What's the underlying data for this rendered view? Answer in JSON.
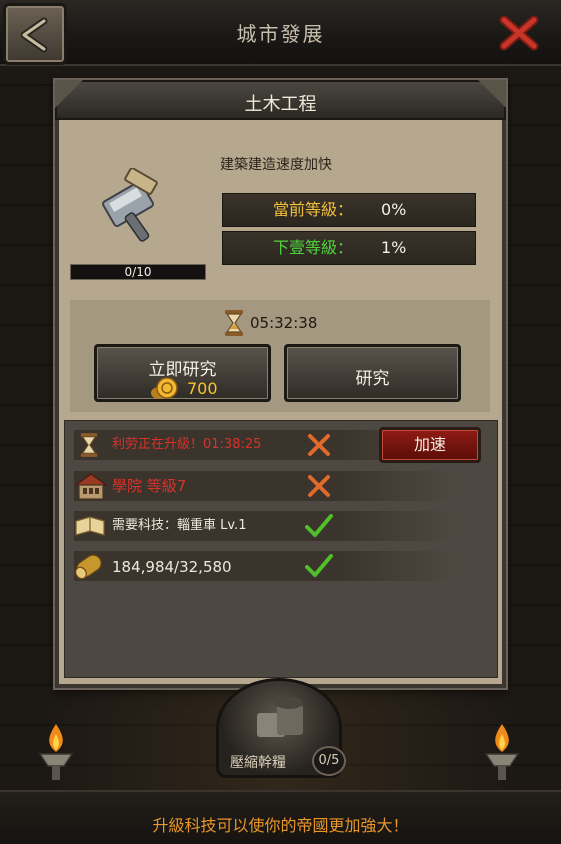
{
  "header": {
    "title": "城市發展"
  },
  "icons": {
    "back": "back-arrow-icon",
    "close": "close-x-icon"
  },
  "panel": {
    "title": "土木工程",
    "description": "建築建造速度加快",
    "progress": {
      "text": "0/10",
      "value": 0,
      "max": 10
    },
    "current_level": {
      "label": "當前等級：",
      "value": "0%"
    },
    "next_level": {
      "label": "下壹等級：",
      "value": "1%"
    }
  },
  "research": {
    "timer": "05:32:38",
    "instant_label": "立即研究",
    "instant_cost": "700",
    "research_label": "研究"
  },
  "requirements": [
    {
      "text": "利劳正在升級！01:38:25",
      "status": "fail",
      "color": "#d8322a"
    },
    {
      "text": "學院 等級7",
      "status": "fail",
      "color": "#d8322a"
    },
    {
      "text": "需要科技：輜重車 Lv.1",
      "status": "ok",
      "color": "#eee8dc"
    },
    {
      "text": "184,984/32,580",
      "status": "ok",
      "color": "#eee8dc"
    }
  ],
  "speed_button": "加速",
  "bottom": {
    "medal_label": "壓縮幹糧",
    "medal_count": "0/5",
    "tip": "升級科技可以使你的帝國更加強大！"
  },
  "colors": {
    "gold": "#f0c03a",
    "green": "#4fd33a",
    "red": "#d8322a",
    "orange": "#e8962a"
  }
}
